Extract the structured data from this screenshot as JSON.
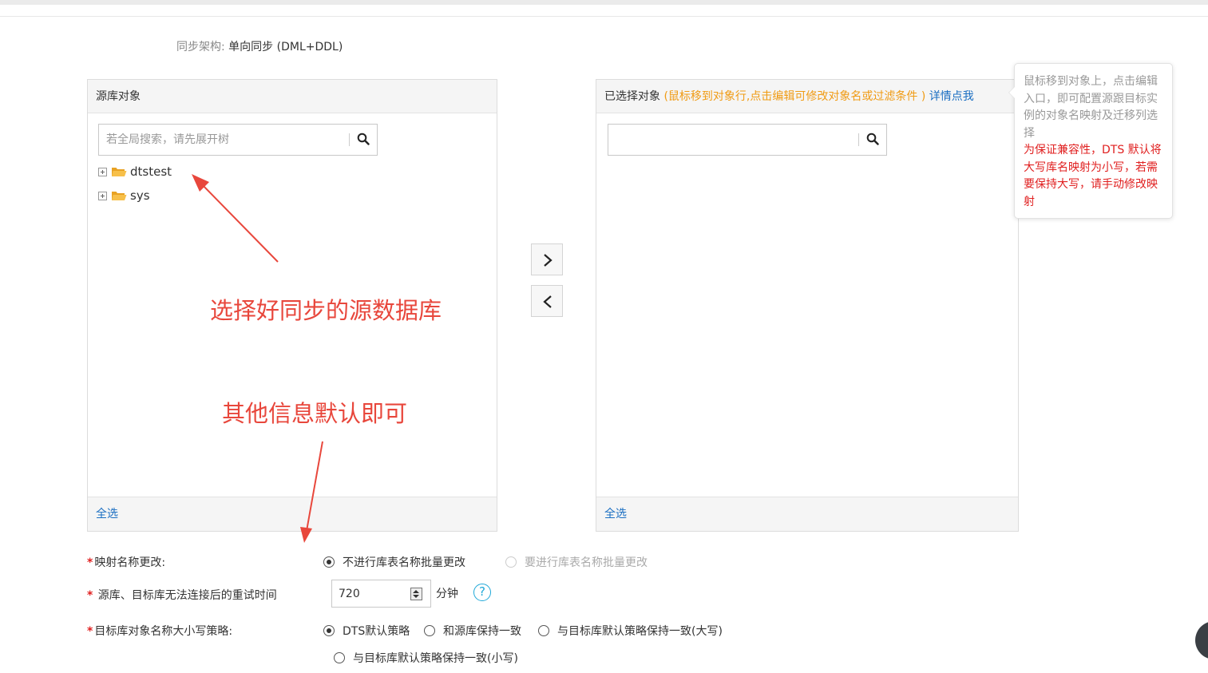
{
  "sync": {
    "architecture_label": "同步架构:",
    "architecture_value": "单向同步 (DML+DDL)"
  },
  "source_panel": {
    "title": "源库对象",
    "search_placeholder": "若全局搜索，请先展开树",
    "tree": [
      {
        "label": "dtstest"
      },
      {
        "label": "sys"
      }
    ],
    "select_all": "全选"
  },
  "selected_panel": {
    "title": "已选择对象",
    "hint": "(鼠标移到对象行,点击编辑可修改对象名或过滤条件 )",
    "link": "详情点我",
    "search_placeholder": "",
    "select_all": "全选"
  },
  "transfer": {
    "move_right_icon": "chevron-right-icon",
    "move_left_icon": "chevron-left-icon"
  },
  "tooltip": {
    "gray_text": "鼠标移到对象上，点击编辑入口，即可配置源跟目标实例的对象名映射及迁移列选择",
    "red_text": "为保证兼容性，DTS 默认将大写库名映射为小写，若需要保持大写，请手动修改映射"
  },
  "annotations": {
    "select_db": "选择好同步的源数据库",
    "default_info": "其他信息默认即可"
  },
  "form": {
    "required_mark": "*",
    "mapping": {
      "label": "映射名称更改:",
      "option_no": "不进行库表名称批量更改",
      "option_yes": "要进行库表名称批量更改"
    },
    "retry": {
      "label": " 源库、目标库无法连接后的重试时间",
      "value": "720",
      "unit": "分钟",
      "help": "?"
    },
    "case_policy": {
      "label": "目标库对象名称大小写策略:",
      "options": [
        "DTS默认策略",
        "和源库保持一致",
        "与目标库默认策略保持一致(大写)",
        "与目标库默认策略保持一致(小写)"
      ]
    }
  },
  "colors": {
    "annotation": "#e8473c",
    "link": "#1a6ec2",
    "hint": "#f09b14",
    "warning": "#e01f1f"
  }
}
